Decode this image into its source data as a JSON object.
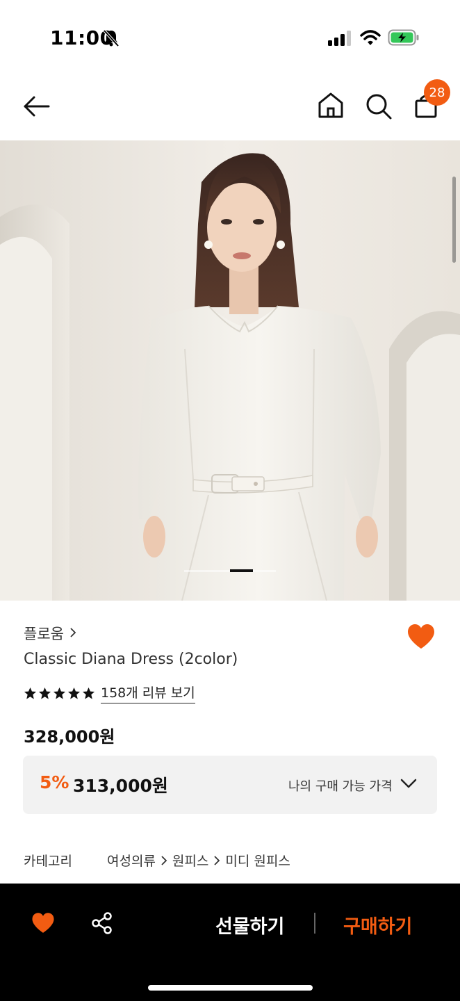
{
  "status_bar": {
    "time": "11:00"
  },
  "header": {
    "cart_count": "28"
  },
  "carousel": {
    "current_index": 2,
    "total": 4
  },
  "product": {
    "brand": "플로움",
    "name": "Classic Diana Dress (2color)",
    "rating_stars": 5,
    "review_link": "158개 리뷰 보기",
    "price_original": "328,000원",
    "discount_rate": "5%",
    "price_sale": "313,000원",
    "my_price_label": "나의 구매 가능 가격",
    "category_label": "카테고리",
    "category_path": [
      "여성의류",
      "원피스",
      "미디 원피스"
    ]
  },
  "bottom_bar": {
    "gift_label": "선물하기",
    "buy_label": "구매하기"
  },
  "colors": {
    "accent": "#f25c12",
    "price_box_bg": "#f2f2f2",
    "bottom_bar_bg": "#000000"
  }
}
